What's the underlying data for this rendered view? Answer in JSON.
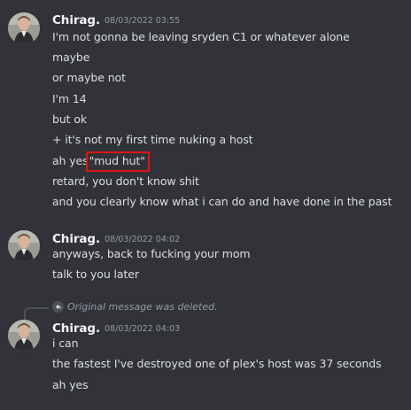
{
  "messages": [
    {
      "author": "Chirag.",
      "timestamp": "08/03/2022 03:55",
      "lines": [
        "I'm not gonna be leaving sryden C1 or whatever alone",
        "maybe",
        "or maybe not",
        "I'm 14",
        "but ok",
        "+ it's not my first time nuking a host",
        "ah yes",
        "retard, you don't know shit",
        "and you clearly know what i can do and have done in the past"
      ],
      "highlighted_text": "\"mud hut\""
    },
    {
      "author": "Chirag.",
      "timestamp": "08/03/2022 04:02",
      "lines": [
        "anyways, back to fucking your mom",
        "talk to you later"
      ]
    },
    {
      "author": "Chirag.",
      "timestamp": "08/03/2022 04:03",
      "reply_reference": "Original message was deleted.",
      "lines": [
        "i can",
        "the fastest I've destroyed one of plex's host was 37 seconds",
        "ah yes"
      ]
    }
  ],
  "colors": {
    "background": "#313338",
    "author": "#f2f3f5",
    "timestamp": "#949ba4",
    "text": "#dbdee1",
    "highlight_box": "#e01414"
  },
  "icons": {
    "avatar": "avatar-icon",
    "reply": "reply-arrow-icon"
  }
}
